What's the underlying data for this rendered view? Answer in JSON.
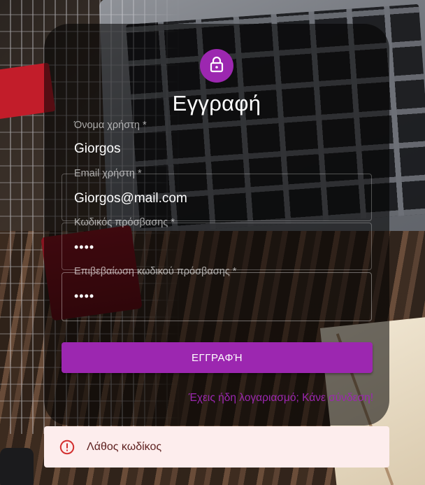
{
  "form": {
    "title": "Εγγραφή",
    "fields": [
      {
        "label": "Όνομα χρήστη *",
        "value": "Giorgos"
      },
      {
        "label": "Email χρήστη *",
        "value": "Giorgos@mail.com"
      },
      {
        "label": "Κωδικός πρόσβασης *",
        "value": "••••"
      },
      {
        "label": "Επιβεβαίωση κωδικού πρόσβασης *",
        "value": "••••"
      }
    ],
    "submit_label": "ΕΓΓΡΑΦΉ",
    "signin_link": "Έχεις ήδη λογαριασμό; Κάνε σύνδεση!"
  },
  "alert": {
    "severity": "error",
    "message": "Λάθος κωδίκος"
  },
  "icons": {
    "header": "lock-icon",
    "alert": "error-outline-icon"
  },
  "colors": {
    "accent": "#9c27b0",
    "alert_bg": "#fdeded",
    "alert_text": "#5f2120",
    "alert_icon": "#d32f2f"
  }
}
